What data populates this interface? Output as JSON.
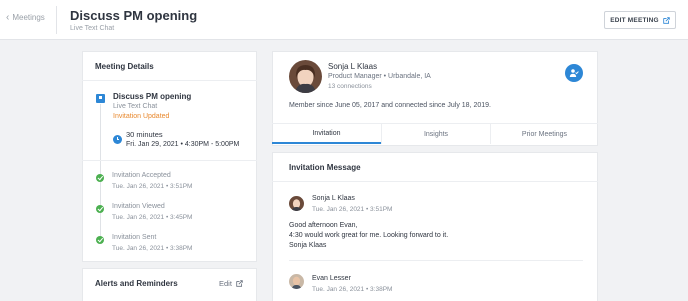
{
  "header": {
    "back_label": "Meetings",
    "title": "Discuss PM opening",
    "subtitle": "Live Text Chat",
    "edit_button_label": "EDIT MEETING"
  },
  "meeting_details": {
    "heading": "Meeting Details",
    "title": "Discuss PM opening",
    "type": "Live Text Chat",
    "status": "Invitation Updated",
    "duration": "30 minutes",
    "datetime": "Fri. Jan 29, 2021  •  4:30PM - 5:00PM",
    "events": [
      {
        "label": "Invitation Accepted",
        "date": "Tue. Jan 26, 2021  •  3:51PM"
      },
      {
        "label": "Invitation Viewed",
        "date": "Tue. Jan 26, 2021  •  3:45PM"
      },
      {
        "label": "Invitation Sent",
        "date": "Tue. Jan 26, 2021  •  3:38PM"
      }
    ]
  },
  "alerts": {
    "heading": "Alerts and Reminders",
    "edit_label": "Edit"
  },
  "profile": {
    "name": "Sonja L Klaas",
    "role_location": "Product Manager  •  Urbandale, IA",
    "connections": "13 connections",
    "member_since": "Member since June 05, 2017 and connected since July 18, 2019."
  },
  "tabs": [
    "Invitation",
    "Insights",
    "Prior Meetings"
  ],
  "invitation_message": {
    "heading": "Invitation Message",
    "messages": [
      {
        "author": "Sonja L Klaas",
        "date": "Tue. Jan 26, 2021  •  3:51PM",
        "body": [
          "Good afternoon Evan,",
          "4:30 would work great for me.  Looking forward to it.",
          "Sonja Klaas"
        ]
      },
      {
        "author": "Evan Lesser",
        "date": "Tue. Jan 26, 2021  •  3:38PM"
      }
    ]
  },
  "colors": {
    "accent": "#2d87d6",
    "status_orange": "#e8892f",
    "success_green": "#4cb050",
    "background": "#f1f2f4"
  }
}
